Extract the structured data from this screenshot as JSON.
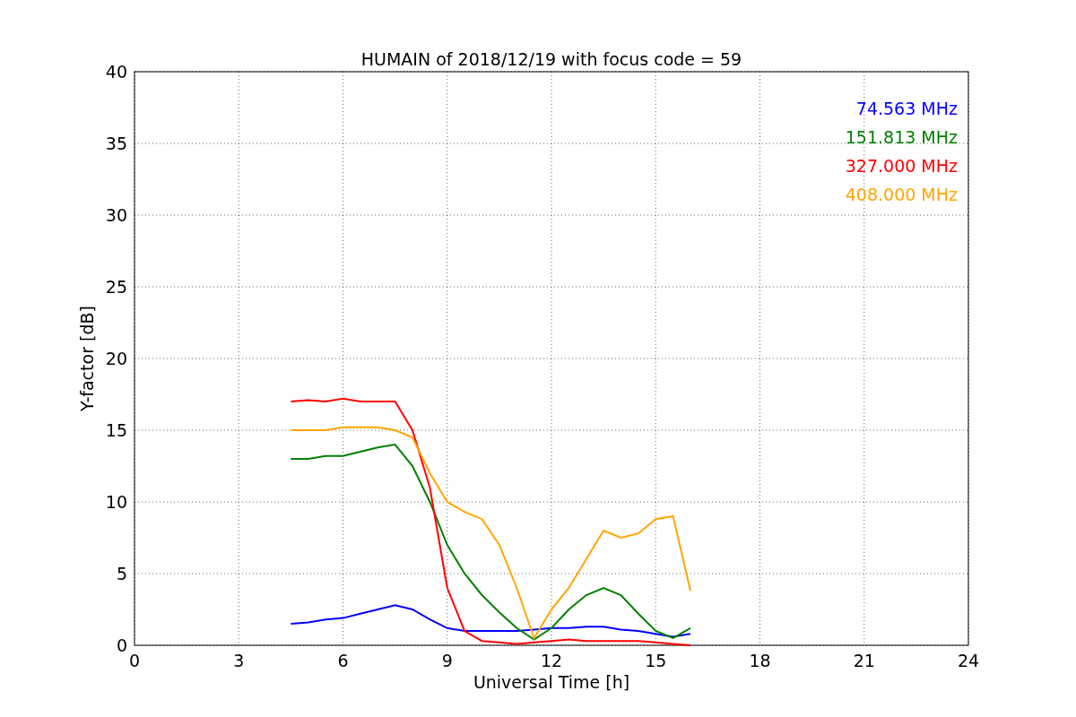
{
  "chart": {
    "chart_data": {
      "type": "line",
      "title": "HUMAIN of 2018/12/19 with focus code = 59",
      "xlabel": "Universal Time [h]",
      "ylabel": "Y-factor [dB]",
      "x": [
        4.5,
        5,
        5.5,
        6,
        6.5,
        7,
        7.5,
        8,
        8.5,
        9,
        9.5,
        10,
        10.5,
        11,
        11.5,
        12,
        12.5,
        13,
        13.5,
        14,
        14.5,
        15,
        15.5,
        16
      ],
      "series": [
        {
          "name": "74.563 MHz",
          "color": "#0000ff",
          "values": [
            1.5,
            1.6,
            1.8,
            1.9,
            2.2,
            2.5,
            2.8,
            2.5,
            1.8,
            1.2,
            1.0,
            1.0,
            1.0,
            1.0,
            1.1,
            1.2,
            1.2,
            1.3,
            1.3,
            1.1,
            1.0,
            0.8,
            0.6,
            0.8
          ]
        },
        {
          "name": "151.813 MHz",
          "color": "#008000",
          "values": [
            13,
            13,
            13.2,
            13.2,
            13.5,
            13.8,
            14,
            12.5,
            10,
            7,
            5,
            3.5,
            2.3,
            1.2,
            0.4,
            1.2,
            2.5,
            3.5,
            4,
            3.5,
            2.2,
            1,
            0.5,
            1.2
          ]
        },
        {
          "name": "327.000 MHz",
          "color": "#ff0000",
          "values": [
            17,
            17.1,
            17,
            17.2,
            17,
            17,
            17,
            15,
            11,
            4,
            1,
            0.3,
            0.2,
            0.1,
            0.2,
            0.3,
            0.4,
            0.3,
            0.3,
            0.3,
            0.3,
            0.2,
            0.1,
            0
          ]
        },
        {
          "name": "408.000 MHz",
          "color": "#ffa500",
          "values": [
            15,
            15,
            15,
            15.2,
            15.2,
            15.2,
            15,
            14.5,
            12,
            10,
            9.3,
            8.8,
            7,
            4,
            0.5,
            2.5,
            4,
            6,
            8,
            7.5,
            7.8,
            8.8,
            9,
            3.8
          ]
        }
      ],
      "grid": true,
      "xlim": [
        0,
        24
      ],
      "ylim": [
        0,
        40
      ],
      "xticks": [
        0,
        3,
        6,
        9,
        12,
        15,
        18,
        21,
        24
      ],
      "yticks": [
        0,
        5,
        10,
        15,
        20,
        25,
        30,
        35,
        40
      ]
    }
  }
}
